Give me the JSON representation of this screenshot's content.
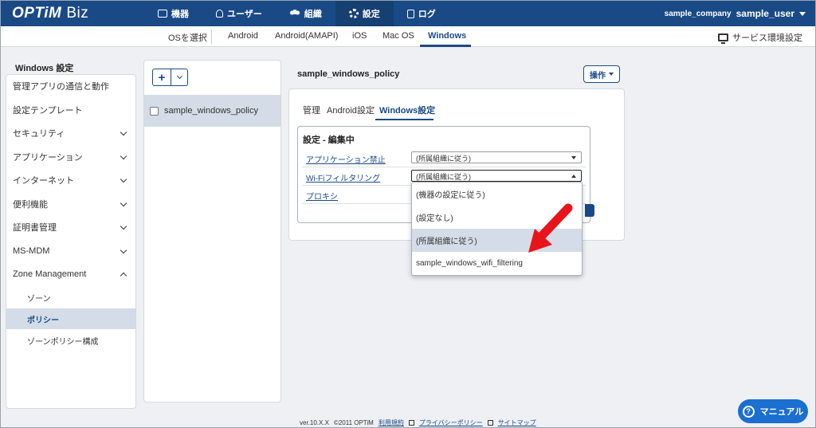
{
  "header": {
    "logo_brand": "OPTiM",
    "logo_product": "Biz",
    "nav": [
      {
        "label": "機器",
        "icon": "device-icon"
      },
      {
        "label": "ユーザー",
        "icon": "user-icon"
      },
      {
        "label": "組織",
        "icon": "organization-icon"
      },
      {
        "label": "設定",
        "icon": "gear-icon"
      },
      {
        "label": "ログ",
        "icon": "log-icon"
      }
    ],
    "company": "sample_company",
    "user": "sample_user"
  },
  "os_bar": {
    "label": "OSを選択",
    "tabs": [
      "Android",
      "Android(AMAPI)",
      "iOS",
      "Mac OS",
      "Windows"
    ],
    "active": "Windows",
    "service_settings": "サービス環境設定"
  },
  "sidebar": {
    "title": "Windows 設定",
    "items": [
      {
        "label": "管理アプリの通信と動作"
      },
      {
        "label": "設定テンプレート"
      },
      {
        "label": "セキュリティ"
      },
      {
        "label": "アプリケーション"
      },
      {
        "label": "インターネット"
      },
      {
        "label": "便利機能"
      },
      {
        "label": "証明書管理"
      },
      {
        "label": "MS-MDM"
      },
      {
        "label": "Zone Management"
      }
    ],
    "sub_items": [
      {
        "label": "ゾーン"
      },
      {
        "label": "ポリシー"
      },
      {
        "label": "ゾーンポリシー構成"
      }
    ]
  },
  "policy_list": {
    "add_label": "+",
    "items": [
      {
        "name": "sample_windows_policy"
      }
    ]
  },
  "detail": {
    "title": "sample_windows_policy",
    "ops_label": "操作",
    "tabs": [
      "管理",
      "Android設定",
      "Windows設定"
    ],
    "active_tab": "Windows設定",
    "settings_title": "設定 - 編集中",
    "rows": [
      {
        "label": "アプリケーション禁止",
        "value": "(所属組織に従う)"
      },
      {
        "label": "Wi-Fiフィルタリング",
        "value": "(所属組織に従う)"
      },
      {
        "label": "プロキシ",
        "value": ""
      }
    ],
    "dropdown_options": [
      "(機器の設定に従う)",
      "(設定なし)",
      "(所属組織に従う)",
      "sample_windows_wifi_filtering"
    ],
    "highlighted_option": "(所属組織に従う)"
  },
  "footer": {
    "version": "ver.10.X.X",
    "copyright": "©2011 OPTiM",
    "terms": "利用規約",
    "privacy": "プライバシーポリシー",
    "sitemap": "サイトマップ"
  },
  "manual_button": "マニュアル",
  "colors": {
    "brand": "#1a4a86",
    "highlight": "#d3dce7",
    "annotation_arrow": "#e8141b",
    "manual": "#1a6fd0"
  }
}
